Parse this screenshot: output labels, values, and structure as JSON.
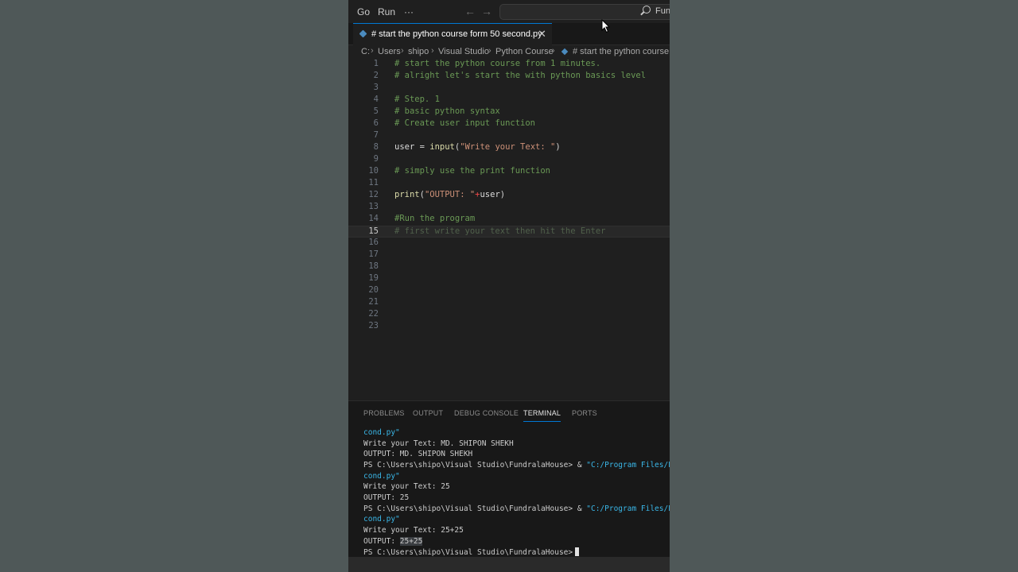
{
  "menu": {
    "go": "Go",
    "run": "Run",
    "more": "···",
    "back_icon": "arrow-left-icon",
    "forward_icon": "arrow-right-icon",
    "search_label": "Func"
  },
  "tab": {
    "title": "# start the python course form 50 second.py",
    "close": "✕"
  },
  "breadcrumb": {
    "items": [
      "C:",
      "Users",
      "shipo",
      "Visual Studio",
      "Python Course",
      "# start the python course f"
    ],
    "separator": "›"
  },
  "editor": {
    "active_line": 15,
    "lines": [
      {
        "n": "1",
        "text": "# start the python course from 1 minutes."
      },
      {
        "n": "2",
        "text": "# alright let's start the with python basics level"
      },
      {
        "n": "3",
        "text": ""
      },
      {
        "n": "4",
        "text": "# Step. 1"
      },
      {
        "n": "5",
        "text": "# basic python syntax"
      },
      {
        "n": "6",
        "text": "# Create user input function"
      },
      {
        "n": "7",
        "text": ""
      },
      {
        "n": "8",
        "var": "user",
        "op": " = ",
        "fn": "input",
        "open": "(",
        "str": "\"Write your Text: \"",
        "close": ")"
      },
      {
        "n": "9",
        "text": ""
      },
      {
        "n": "10",
        "text": "# simply use the print function"
      },
      {
        "n": "11",
        "text": ""
      },
      {
        "n": "12",
        "fn": "print",
        "open": "(",
        "str": "\"OUTPUT: \"",
        "plus": "+",
        "id": "user",
        "close": ")"
      },
      {
        "n": "13",
        "text": ""
      },
      {
        "n": "14",
        "text": "#Run the program"
      },
      {
        "n": "15",
        "text": "# first write your text then hit the Enter"
      },
      {
        "n": "16",
        "text": ""
      },
      {
        "n": "17",
        "text": ""
      },
      {
        "n": "18",
        "text": ""
      },
      {
        "n": "19",
        "text": ""
      },
      {
        "n": "20",
        "text": ""
      },
      {
        "n": "21",
        "text": ""
      },
      {
        "n": "22",
        "text": ""
      },
      {
        "n": "23",
        "text": ""
      }
    ]
  },
  "panel": {
    "tabs": [
      "PROBLEMS",
      "OUTPUT",
      "DEBUG CONSOLE",
      "TERMINAL",
      "PORTS"
    ],
    "active_tab": "TERMINAL"
  },
  "terminal": {
    "l1": "cond.py\"",
    "l2": "Write your Text: MD. SHIPON SHEKH",
    "l3": "OUTPUT: MD. SHIPON SHEKH",
    "l4_prompt": "PS C:\\Users\\shipo\\Visual Studio\\FundralaHouse> & ",
    "l4_str": "\"C:/Program Files/Py",
    "l5": "cond.py\"",
    "l6": "Write your Text: 25",
    "l7": "OUTPUT: 25",
    "l8_prompt": "PS C:\\Users\\shipo\\Visual Studio\\FundralaHouse> & ",
    "l8_str": "\"C:/Program Files/Py",
    "l9": "cond.py\"",
    "l10": "Write your Text: 25+25",
    "l11_label": "OUTPUT: ",
    "l11_value": "25+25",
    "l12_prompt": "PS C:\\Users\\shipo\\Visual Studio\\FundralaHouse>"
  }
}
